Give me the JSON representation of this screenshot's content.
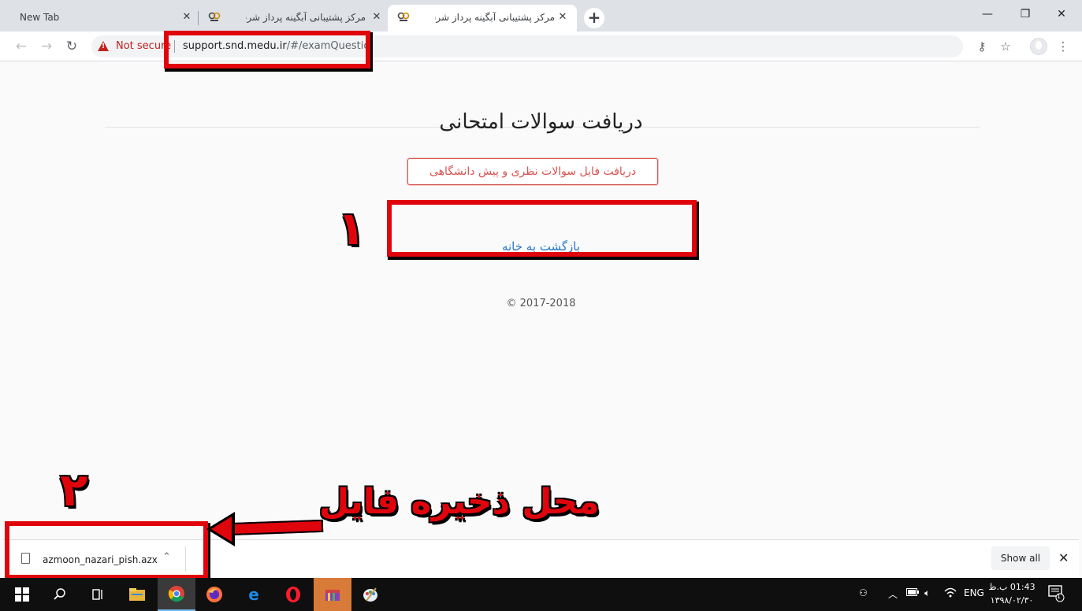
{
  "browser": {
    "tabs": [
      {
        "title": "New Tab",
        "active": false
      },
      {
        "title": "مرکز پشتیبانی آبگینه پرداز شرق",
        "active": false
      },
      {
        "title": "مرکز پشتیبانی آبگینه پرداز شرق",
        "active": true
      }
    ],
    "new_tab_symbol": "+",
    "window_controls": {
      "minimize": "—",
      "maximize": "❐",
      "close": "✕"
    },
    "security_label": "Not secure",
    "url_host": "support.snd.medu.ir",
    "url_path": "/#/examQuestion",
    "toolbar_icons": [
      "back-icon",
      "forward-icon",
      "reload-icon",
      "key-icon",
      "star-icon",
      "profile-icon",
      "menu-icon"
    ]
  },
  "page": {
    "title": "دریافت سوالات امتحانی",
    "download_button": "دریافت فایل سوالات نظری و پیش دانشگاهی",
    "home_link": "بازگشت به خانه",
    "copyright": "© 2017-2018"
  },
  "annotations": {
    "step1": "۱",
    "step2": "۲",
    "label": "محل ذخیره فایل",
    "color": "#e0050d"
  },
  "downloads": {
    "file_name": "azmoon_nazari_pish.azx",
    "show_all": "Show all"
  },
  "taskbar": {
    "apps": [
      "windows-start-icon",
      "search-icon",
      "task-view-icon",
      "file-explorer-icon",
      "chrome-icon",
      "firefox-icon",
      "edge-icon",
      "opera-icon",
      "winrar-icon",
      "paint-icon"
    ],
    "language": "ENG",
    "time": "01:43 ب.ظ",
    "date": "۱۳۹۸/۰۲/۳۰",
    "notification_count": "1"
  }
}
